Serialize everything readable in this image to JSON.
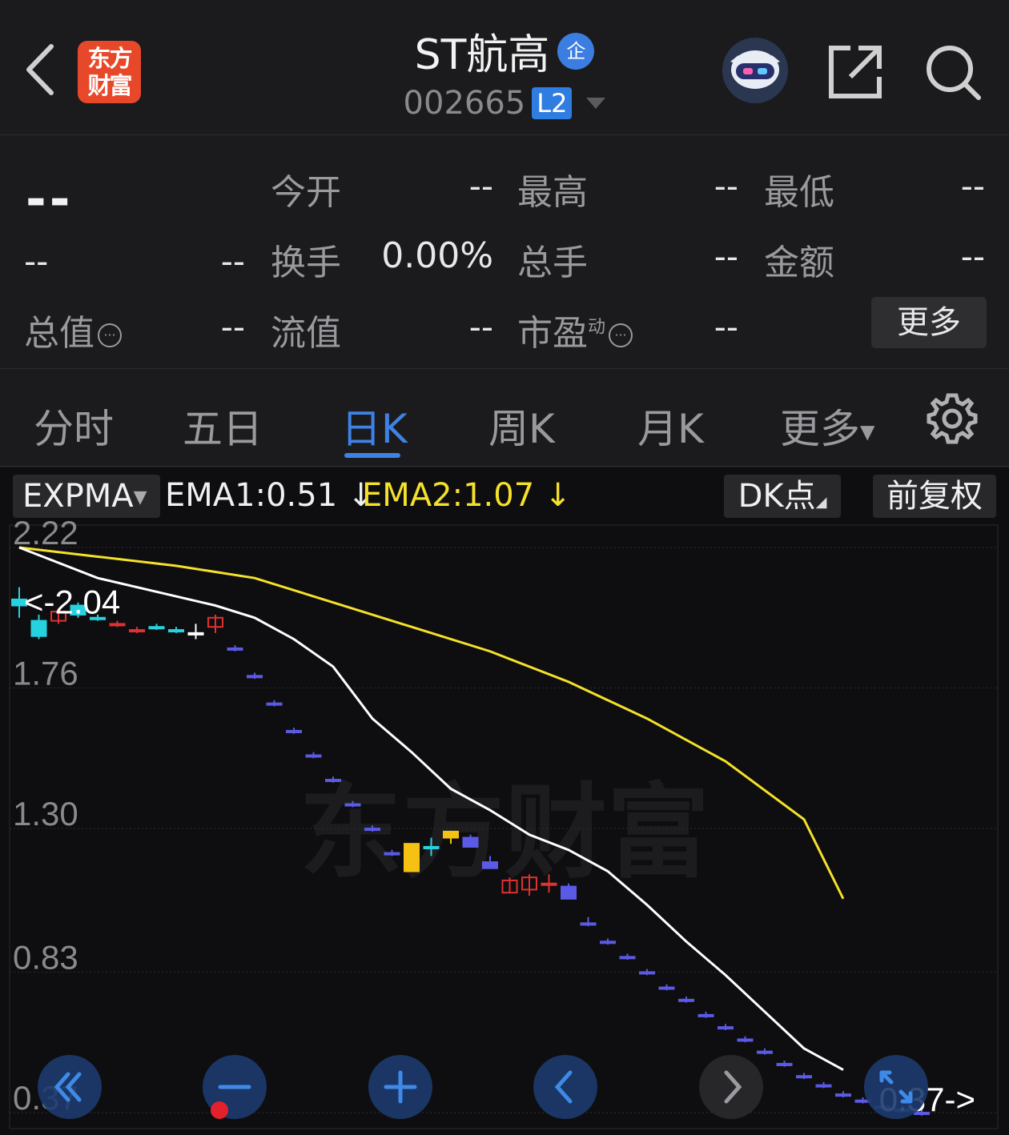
{
  "header": {
    "logo_text": "东方财富",
    "stock_name": "ST航高",
    "badge": "企",
    "code": "002665",
    "level": "L2"
  },
  "quote": {
    "price": "--",
    "change": "--",
    "change_pct": "--",
    "open_label": "今开",
    "open_value": "--",
    "high_label": "最高",
    "high_value": "--",
    "low_label": "最低",
    "low_value": "--",
    "turnover_label": "换手",
    "turnover_value": "0.00%",
    "volume_label": "总手",
    "volume_value": "--",
    "amount_label": "金额",
    "amount_value": "--",
    "mktcap_label": "总值",
    "mktcap_value": "--",
    "float_label": "流值",
    "float_value": "--",
    "pe_label": "市盈",
    "pe_sup": "动",
    "pe_value": "--",
    "more_label": "更多"
  },
  "tabs": [
    "分时",
    "五日",
    "日K",
    "周K",
    "月K",
    "更多"
  ],
  "active_tab": "日K",
  "indicator": {
    "name": "EXPMA",
    "ema1": "EMA1:0.51 ↓",
    "ema2": "EMA2:1.07 ↓",
    "dk_label": "DK点",
    "adjust_label": "前复权",
    "watermark": "东方财富"
  },
  "colors": {
    "up": "#e03030",
    "down_cyan": "#27d2e0",
    "down_blue": "#5a5ae6",
    "yellow": "#f5c214",
    "ema1": "#ffffff",
    "ema2": "#f5e12a",
    "accent": "#3e82e6"
  },
  "chart_data": {
    "type": "candlestick",
    "y_ticks": [
      "2.22",
      "1.76",
      "1.30",
      "0.83",
      "0.37"
    ],
    "ylim": [
      0.37,
      2.22
    ],
    "high_marker": "<-2.04",
    "low_marker": "0.37->",
    "series": [
      {
        "name": "EMA1",
        "value_label": "0.51"
      },
      {
        "name": "EMA2",
        "value_label": "1.07"
      }
    ],
    "ema1": [
      [
        0,
        2.22
      ],
      [
        4,
        2.12
      ],
      [
        8,
        2.06
      ],
      [
        10,
        2.03
      ],
      [
        12,
        1.99
      ],
      [
        14,
        1.92
      ],
      [
        16,
        1.83
      ],
      [
        18,
        1.66
      ],
      [
        20,
        1.55
      ],
      [
        22,
        1.43
      ],
      [
        24,
        1.36
      ],
      [
        26,
        1.28
      ],
      [
        28,
        1.23
      ],
      [
        30,
        1.16
      ],
      [
        32,
        1.05
      ],
      [
        34,
        0.93
      ],
      [
        36,
        0.82
      ],
      [
        38,
        0.7
      ],
      [
        40,
        0.58
      ],
      [
        42,
        0.51
      ]
    ],
    "ema2": [
      [
        0,
        2.22
      ],
      [
        4,
        2.19
      ],
      [
        8,
        2.16
      ],
      [
        12,
        2.12
      ],
      [
        16,
        2.04
      ],
      [
        20,
        1.96
      ],
      [
        24,
        1.88
      ],
      [
        28,
        1.78
      ],
      [
        32,
        1.66
      ],
      [
        36,
        1.52
      ],
      [
        40,
        1.33
      ],
      [
        42,
        1.07
      ]
    ],
    "candles": [
      {
        "o": 2.05,
        "c": 2.03,
        "h": 2.09,
        "l": 1.99,
        "k": "c"
      },
      {
        "o": 1.98,
        "c": 1.93,
        "h": 2.0,
        "l": 1.92,
        "k": "c"
      },
      {
        "o": 1.98,
        "c": 2.01,
        "h": 2.02,
        "l": 1.97,
        "k": "u"
      },
      {
        "o": 2.03,
        "c": 2.0,
        "h": 2.04,
        "l": 1.99,
        "k": "c"
      },
      {
        "o": 1.99,
        "c": 1.99,
        "h": 2.0,
        "l": 1.98,
        "k": "c"
      },
      {
        "o": 1.97,
        "c": 1.97,
        "h": 1.98,
        "l": 1.96,
        "k": "u"
      },
      {
        "o": 1.95,
        "c": 1.95,
        "h": 1.96,
        "l": 1.94,
        "k": "u"
      },
      {
        "o": 1.96,
        "c": 1.96,
        "h": 1.97,
        "l": 1.95,
        "k": "c"
      },
      {
        "o": 1.95,
        "c": 1.95,
        "h": 1.96,
        "l": 1.94,
        "k": "c"
      },
      {
        "o": 1.94,
        "c": 1.94,
        "h": 1.97,
        "l": 1.92,
        "k": "w"
      },
      {
        "o": 1.96,
        "c": 1.99,
        "h": 2.0,
        "l": 1.94,
        "k": "u"
      },
      {
        "o": 1.89,
        "c": 1.89,
        "h": 1.9,
        "l": 1.88,
        "k": "b"
      },
      {
        "o": 1.8,
        "c": 1.8,
        "h": 1.81,
        "l": 1.79,
        "k": "b"
      },
      {
        "o": 1.71,
        "c": 1.71,
        "h": 1.72,
        "l": 1.7,
        "k": "b"
      },
      {
        "o": 1.62,
        "c": 1.62,
        "h": 1.63,
        "l": 1.61,
        "k": "b"
      },
      {
        "o": 1.54,
        "c": 1.54,
        "h": 1.55,
        "l": 1.53,
        "k": "b"
      },
      {
        "o": 1.46,
        "c": 1.46,
        "h": 1.47,
        "l": 1.45,
        "k": "b"
      },
      {
        "o": 1.38,
        "c": 1.38,
        "h": 1.39,
        "l": 1.37,
        "k": "b"
      },
      {
        "o": 1.3,
        "c": 1.3,
        "h": 1.31,
        "l": 1.29,
        "k": "b"
      },
      {
        "o": 1.22,
        "c": 1.22,
        "h": 1.23,
        "l": 1.21,
        "k": "b"
      },
      {
        "o": 1.16,
        "c": 1.25,
        "h": 1.25,
        "l": 1.16,
        "k": "y"
      },
      {
        "o": 1.24,
        "c": 1.24,
        "h": 1.27,
        "l": 1.21,
        "k": "c"
      },
      {
        "o": 1.27,
        "c": 1.29,
        "h": 1.29,
        "l": 1.25,
        "k": "y"
      },
      {
        "o": 1.27,
        "c": 1.24,
        "h": 1.28,
        "l": 1.24,
        "k": "b"
      },
      {
        "o": 1.19,
        "c": 1.17,
        "h": 1.21,
        "l": 1.17,
        "k": "b"
      },
      {
        "o": 1.09,
        "c": 1.13,
        "h": 1.14,
        "l": 1.09,
        "k": "u"
      },
      {
        "o": 1.1,
        "c": 1.14,
        "h": 1.15,
        "l": 1.08,
        "k": "u"
      },
      {
        "o": 1.12,
        "c": 1.12,
        "h": 1.15,
        "l": 1.09,
        "k": "u"
      },
      {
        "o": 1.11,
        "c": 1.07,
        "h": 1.12,
        "l": 1.07,
        "k": "b"
      },
      {
        "o": 0.99,
        "c": 0.99,
        "h": 1.01,
        "l": 0.98,
        "k": "b"
      },
      {
        "o": 0.93,
        "c": 0.93,
        "h": 0.94,
        "l": 0.92,
        "k": "b"
      },
      {
        "o": 0.88,
        "c": 0.88,
        "h": 0.89,
        "l": 0.87,
        "k": "b"
      },
      {
        "o": 0.83,
        "c": 0.83,
        "h": 0.84,
        "l": 0.82,
        "k": "b"
      },
      {
        "o": 0.78,
        "c": 0.78,
        "h": 0.79,
        "l": 0.77,
        "k": "b"
      },
      {
        "o": 0.74,
        "c": 0.74,
        "h": 0.75,
        "l": 0.73,
        "k": "b"
      },
      {
        "o": 0.69,
        "c": 0.69,
        "h": 0.7,
        "l": 0.68,
        "k": "b"
      },
      {
        "o": 0.65,
        "c": 0.65,
        "h": 0.66,
        "l": 0.64,
        "k": "b"
      },
      {
        "o": 0.61,
        "c": 0.61,
        "h": 0.62,
        "l": 0.6,
        "k": "b"
      },
      {
        "o": 0.57,
        "c": 0.57,
        "h": 0.58,
        "l": 0.56,
        "k": "b"
      },
      {
        "o": 0.53,
        "c": 0.53,
        "h": 0.54,
        "l": 0.52,
        "k": "b"
      },
      {
        "o": 0.49,
        "c": 0.49,
        "h": 0.5,
        "l": 0.48,
        "k": "b"
      },
      {
        "o": 0.46,
        "c": 0.46,
        "h": 0.47,
        "l": 0.45,
        "k": "b"
      },
      {
        "o": 0.43,
        "c": 0.43,
        "h": 0.44,
        "l": 0.42,
        "k": "b"
      },
      {
        "o": 0.41,
        "c": 0.41,
        "h": 0.42,
        "l": 0.4,
        "k": "b"
      },
      {
        "o": 0.39,
        "c": 0.39,
        "h": 0.4,
        "l": 0.38,
        "k": "b"
      },
      {
        "o": 0.38,
        "c": 0.38,
        "h": 0.39,
        "l": 0.37,
        "k": "b"
      },
      {
        "o": 0.37,
        "c": 0.37,
        "h": 0.38,
        "l": 0.36,
        "k": "b"
      }
    ]
  },
  "controls": [
    "scroll-left-fast-icon",
    "zoom-out-icon",
    "zoom-in-icon",
    "prev-icon",
    "next-icon",
    "fullscreen-icon"
  ]
}
